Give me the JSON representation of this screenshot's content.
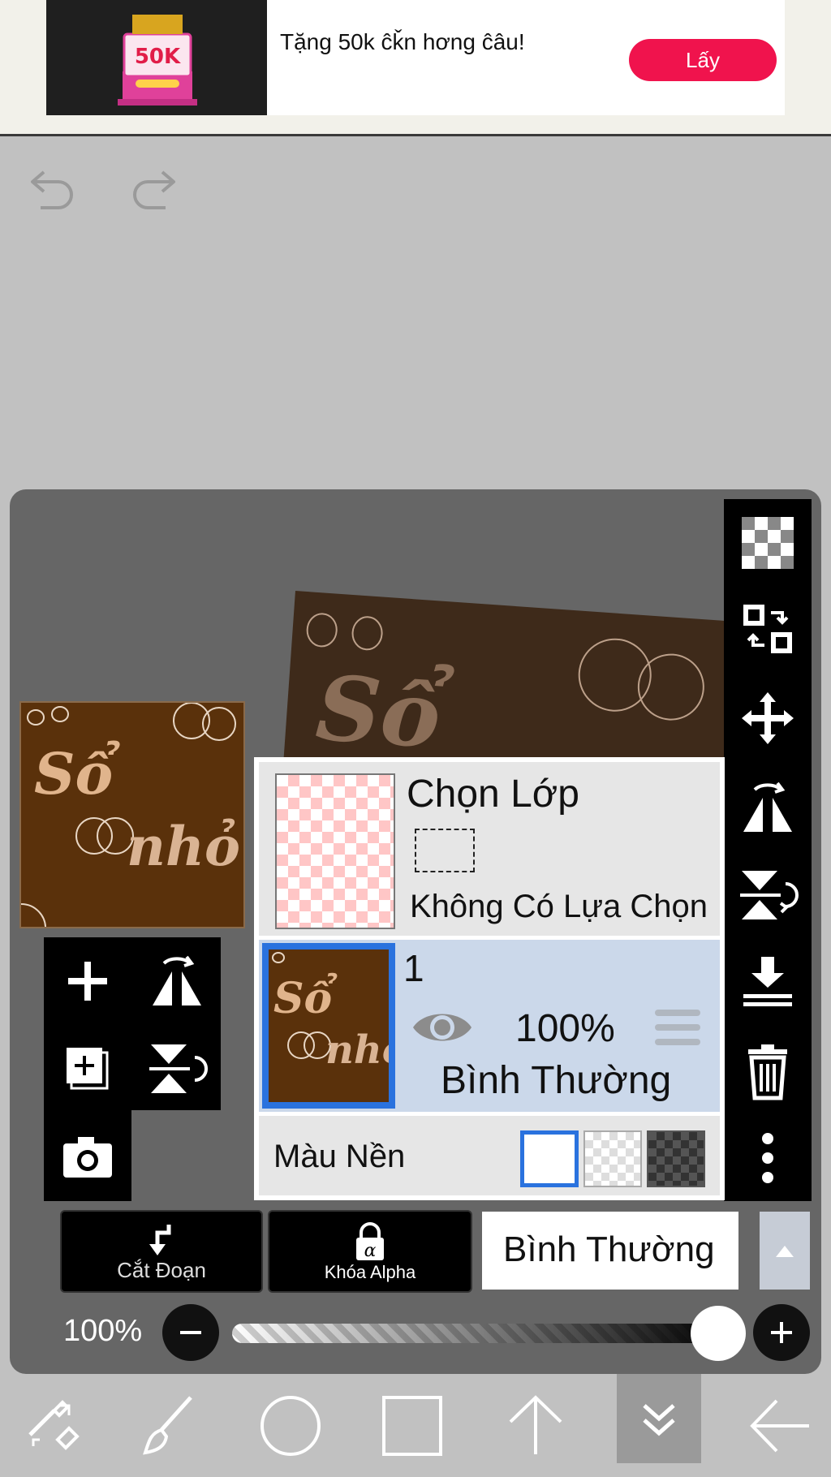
{
  "ad": {
    "text": "Tặng 50k ĉǩn hơng ĉâu!",
    "button_label": "Lấy",
    "image_badge": "50K",
    "accent_color": "#f0134d"
  },
  "toolbar_top": {
    "undo_icon": "undo-icon",
    "redo_icon": "redo-icon"
  },
  "right_toolbar": {
    "items": [
      "checker-icon",
      "transform-layer-icon",
      "move-icon",
      "flip-horizontal-icon",
      "flip-vertical-icon",
      "merge-down-icon",
      "trash-icon",
      "more-vertical-icon"
    ]
  },
  "layer_panel": {
    "selection": {
      "title": "Chọn Lớp",
      "status": "Không Có Lựa Chọn"
    },
    "layer": {
      "name": "1",
      "opacity": "100%",
      "blend_mode": "Bình Thường"
    },
    "background": {
      "label": "Màu Nền",
      "options": [
        "white",
        "transparent",
        "dark"
      ],
      "selected": "white"
    }
  },
  "bottom_controls": {
    "clip_label": "Cắt Đoạn",
    "alpha_lock_label": "Khóa Alpha",
    "blend_mode": "Bình Thường",
    "opacity_label": "100%",
    "opacity_value": 1.0
  },
  "bottom_nav": {
    "items": [
      "transform-tools-icon",
      "brush-icon",
      "circle-icon",
      "square-icon",
      "arrow-up-icon",
      "chevron-double-down-icon",
      "arrow-left-icon"
    ],
    "active_index": 5
  },
  "artwork_text": [
    "Sổ",
    "nhỏ"
  ]
}
